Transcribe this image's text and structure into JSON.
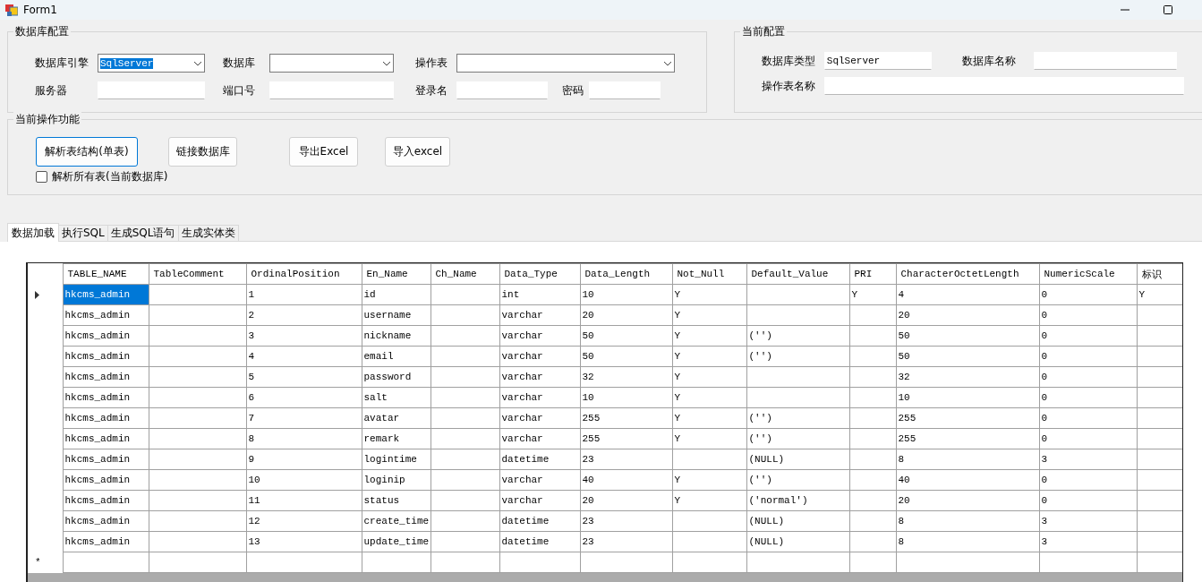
{
  "window": {
    "title": "Form1"
  },
  "db_config": {
    "title": "数据库配置",
    "rows": [
      [
        {
          "label": "数据库引擎",
          "kind": "combo",
          "value": "SqlServer",
          "text_selected": true
        },
        {
          "label": "数据库",
          "kind": "combo"
        },
        {
          "label": "操作表",
          "kind": "combo"
        }
      ],
      [
        {
          "label": "服务器",
          "kind": "text"
        },
        {
          "label": "端口号",
          "kind": "text"
        },
        {
          "label": "登录名",
          "kind": "text"
        },
        {
          "label": "密码",
          "kind": "text"
        }
      ]
    ]
  },
  "current_config": {
    "title": "当前配置",
    "rows": [
      [
        {
          "label": "数据库类型",
          "value": "SqlServer"
        },
        {
          "label": "数据库名称"
        }
      ],
      [
        {
          "label": "操作表名称"
        }
      ]
    ]
  },
  "actions": {
    "title": "当前操作功能",
    "buttons": [
      {
        "label": "解析表结构(单表)",
        "focused": true
      },
      {
        "label": "链接数据库",
        "focused": false
      },
      {
        "label": "导出Excel",
        "focused": false
      },
      {
        "label": "导入excel",
        "focused": false
      }
    ],
    "checkbox": {
      "label": "解析所有表(当前数据库)",
      "checked": false
    }
  },
  "tabs": [
    {
      "label": "数据加载",
      "selected": true
    },
    {
      "label": "执行SQL",
      "selected": false
    },
    {
      "label": "生成SQL语句",
      "selected": false
    },
    {
      "label": "生成实体类",
      "selected": false
    }
  ],
  "table": {
    "columns": [
      "TABLE_NAME",
      "TableComment",
      "OrdinalPosition",
      "En_Name",
      "Ch_Name",
      "Data_Type",
      "Data_Length",
      "Not_Null",
      "Default_Value",
      "PRI",
      "CharacterOctetLength",
      "NumericScale",
      "标识"
    ],
    "rows": [
      {
        "selected": true,
        "cells": [
          "hkcms_admin",
          "",
          "1",
          "id",
          "",
          "int",
          "10",
          "Y",
          "",
          "Y",
          "4",
          "0",
          "Y"
        ]
      },
      {
        "selected": false,
        "cells": [
          "hkcms_admin",
          "",
          "2",
          "username",
          "",
          "varchar",
          "20",
          "Y",
          "",
          "",
          "20",
          "0",
          ""
        ]
      },
      {
        "selected": false,
        "cells": [
          "hkcms_admin",
          "",
          "3",
          "nickname",
          "",
          "varchar",
          "50",
          "Y",
          "('')",
          "",
          "50",
          "0",
          ""
        ]
      },
      {
        "selected": false,
        "cells": [
          "hkcms_admin",
          "",
          "4",
          "email",
          "",
          "varchar",
          "50",
          "Y",
          "('')",
          "",
          "50",
          "0",
          ""
        ]
      },
      {
        "selected": false,
        "cells": [
          "hkcms_admin",
          "",
          "5",
          "password",
          "",
          "varchar",
          "32",
          "Y",
          "",
          "",
          "32",
          "0",
          ""
        ]
      },
      {
        "selected": false,
        "cells": [
          "hkcms_admin",
          "",
          "6",
          "salt",
          "",
          "varchar",
          "10",
          "Y",
          "",
          "",
          "10",
          "0",
          ""
        ]
      },
      {
        "selected": false,
        "cells": [
          "hkcms_admin",
          "",
          "7",
          "avatar",
          "",
          "varchar",
          "255",
          "Y",
          "('')",
          "",
          "255",
          "0",
          ""
        ]
      },
      {
        "selected": false,
        "cells": [
          "hkcms_admin",
          "",
          "8",
          "remark",
          "",
          "varchar",
          "255",
          "Y",
          "('')",
          "",
          "255",
          "0",
          ""
        ]
      },
      {
        "selected": false,
        "cells": [
          "hkcms_admin",
          "",
          "9",
          "logintime",
          "",
          "datetime",
          "23",
          "",
          "(NULL)",
          "",
          "8",
          "3",
          ""
        ]
      },
      {
        "selected": false,
        "cells": [
          "hkcms_admin",
          "",
          "10",
          "loginip",
          "",
          "varchar",
          "40",
          "Y",
          "('')",
          "",
          "40",
          "0",
          ""
        ]
      },
      {
        "selected": false,
        "cells": [
          "hkcms_admin",
          "",
          "11",
          "status",
          "",
          "varchar",
          "20",
          "Y",
          "('normal')",
          "",
          "20",
          "0",
          ""
        ]
      },
      {
        "selected": false,
        "cells": [
          "hkcms_admin",
          "",
          "12",
          "create_time",
          "",
          "datetime",
          "23",
          "",
          "(NULL)",
          "",
          "8",
          "3",
          ""
        ]
      },
      {
        "selected": false,
        "cells": [
          "hkcms_admin",
          "",
          "13",
          "update_time",
          "",
          "datetime",
          "23",
          "",
          "(NULL)",
          "",
          "8",
          "3",
          ""
        ]
      }
    ],
    "new_row_marker": "*"
  }
}
